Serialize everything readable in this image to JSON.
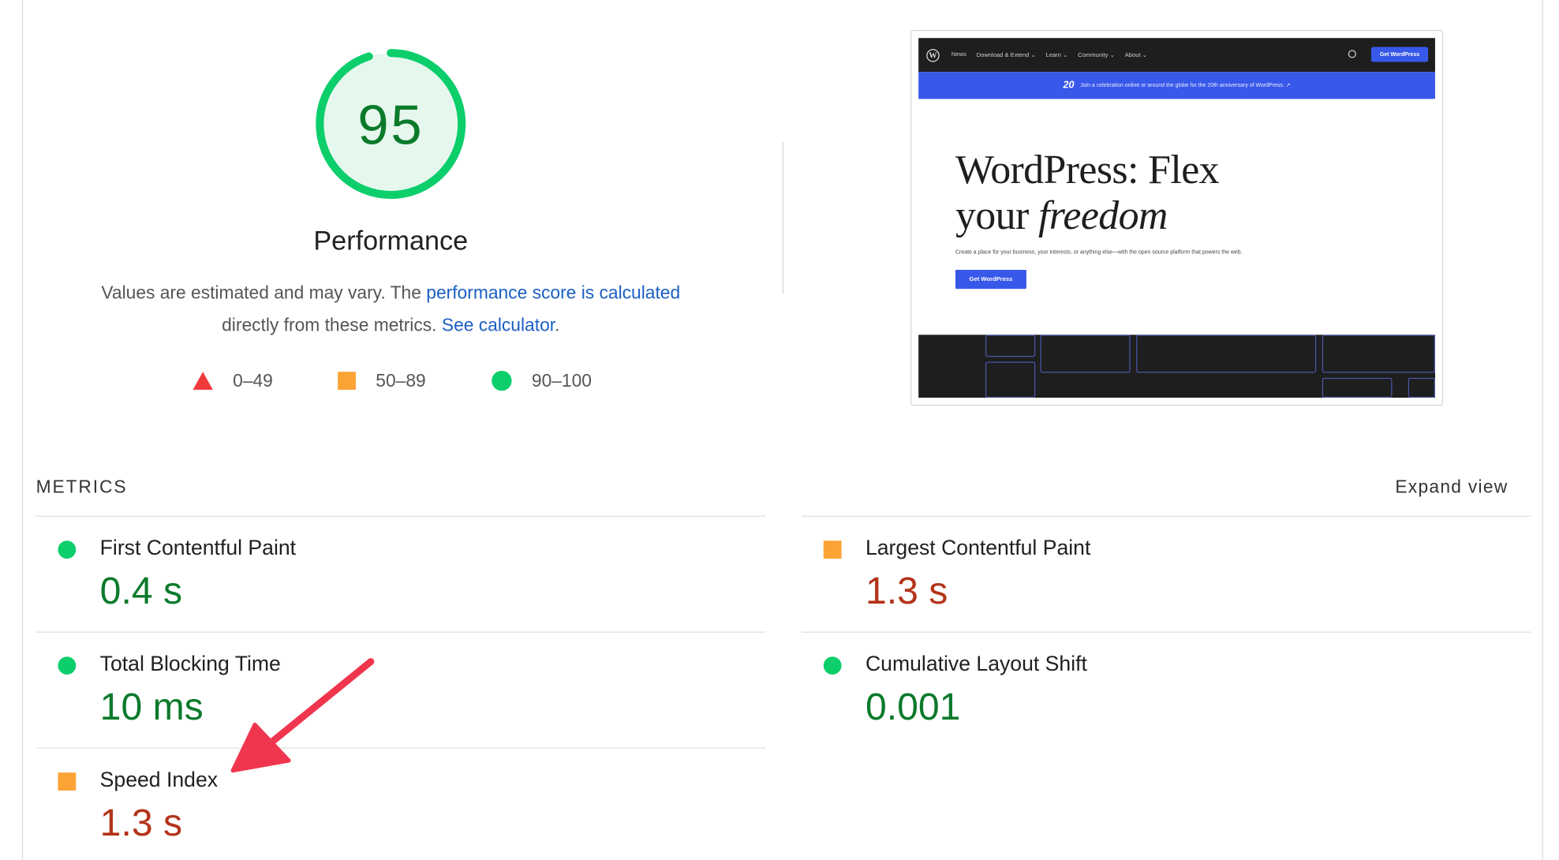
{
  "score": {
    "value": "95",
    "fraction": 0.95,
    "color": "#0cce6b",
    "fill": "#e6f8ee"
  },
  "performance": {
    "title": "Performance",
    "desc_pre": "Values are estimated and may vary. The ",
    "desc_link1": "performance score is calculated",
    "desc_mid": " directly from these metrics. ",
    "desc_link2": "See calculator",
    "desc_end": "."
  },
  "legend": [
    {
      "icon": "red-triangle-icon",
      "range": "0–49"
    },
    {
      "icon": "orange-square-icon",
      "range": "50–89"
    },
    {
      "icon": "green-circle-icon",
      "range": "90–100"
    }
  ],
  "thumbnail": {
    "nav_items": [
      "News",
      "Download & Extend ⌄",
      "Learn ⌄",
      "Community ⌄",
      "About ⌄"
    ],
    "get_button": "Get WordPress",
    "banner_num": "20",
    "banner_text": "Join a celebration online or around the globe for the 20th anniversary of WordPress. ↗",
    "hero_title_line1": "WordPress: Flex",
    "hero_title_line2a": "your ",
    "hero_title_line2b": "freedom",
    "hero_sub": "Create a place for your business, your interests, or anything else—with the open source platform that powers the web.",
    "hero_button": "Get WordPress"
  },
  "metrics": {
    "heading": "METRICS",
    "expand": "Expand view",
    "items": [
      {
        "name": "First Contentful Paint",
        "value": "0.4 s",
        "rating": "good"
      },
      {
        "name": "Largest Contentful Paint",
        "value": "1.3 s",
        "rating": "average"
      },
      {
        "name": "Total Blocking Time",
        "value": "10 ms",
        "rating": "good"
      },
      {
        "name": "Cumulative Layout Shift",
        "value": "0.001",
        "rating": "good"
      },
      {
        "name": "Speed Index",
        "value": "1.3 s",
        "rating": "average"
      }
    ]
  },
  "colors": {
    "good": "#0b7a2b",
    "average": "#b3341a",
    "link": "#1a5fc4",
    "arrow": "#f0364e"
  }
}
